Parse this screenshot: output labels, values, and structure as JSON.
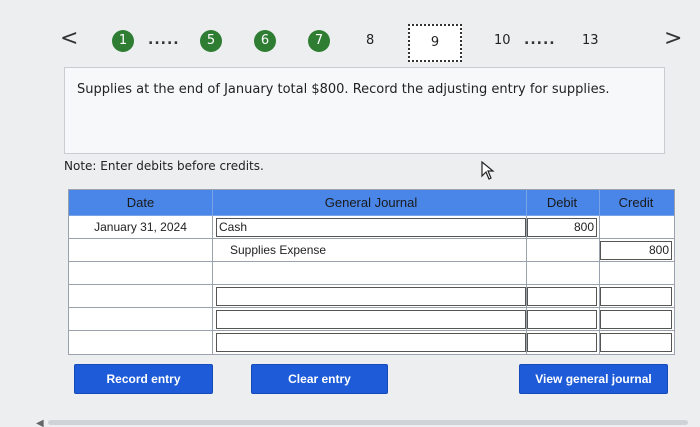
{
  "nav": {
    "prev": "<",
    "next": ">",
    "steps": [
      "1",
      "5",
      "6",
      "7"
    ],
    "plain_steps": [
      "8",
      "10",
      "13"
    ],
    "current": "9",
    "dots": "....."
  },
  "question": {
    "text": "Supplies at the end of January total $800. Record the adjusting entry for supplies."
  },
  "note": "Note: Enter debits before credits.",
  "journal": {
    "headers": {
      "date": "Date",
      "journal": "General Journal",
      "debit": "Debit",
      "credit": "Credit"
    },
    "rows": [
      {
        "date": "January 31, 2024",
        "account": "Cash",
        "debit": "800",
        "credit": ""
      },
      {
        "date": "",
        "account": "Supplies Expense",
        "debit": "",
        "credit": "800"
      },
      {
        "date": "",
        "account": "",
        "debit": "",
        "credit": ""
      },
      {
        "date": "",
        "account": "",
        "debit": "",
        "credit": ""
      },
      {
        "date": "",
        "account": "",
        "debit": "",
        "credit": ""
      },
      {
        "date": "",
        "account": "",
        "debit": "",
        "credit": ""
      }
    ]
  },
  "buttons": {
    "record": "Record entry",
    "clear": "Clear entry",
    "view": "View general journal"
  },
  "colors": {
    "step_green": "#2e7d32",
    "header_blue": "#4a86e8",
    "button_blue": "#1d5bd8"
  }
}
